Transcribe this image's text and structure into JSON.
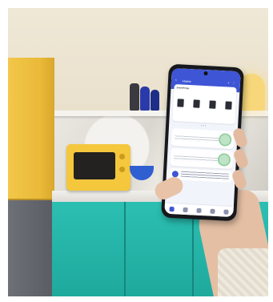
{
  "scene": {
    "description_colors": {
      "cabinet": "#1fa99d",
      "fridge_top": "#f3c74a",
      "toaster_oven": "#f4c73c",
      "app_accent": "#3e55d6"
    }
  },
  "phone_app": {
    "header": {
      "back_icon": "back-arrow-icon",
      "title": "Home",
      "actions": "+  ⋮"
    },
    "overview_card": {
      "heading": "SmartThings",
      "devices": [
        "device-1",
        "device-2",
        "device-3",
        "device-4"
      ]
    },
    "tabs": [
      "home-tab",
      "devices-tab",
      "life-tab",
      "automation-tab",
      "menu-tab"
    ]
  }
}
